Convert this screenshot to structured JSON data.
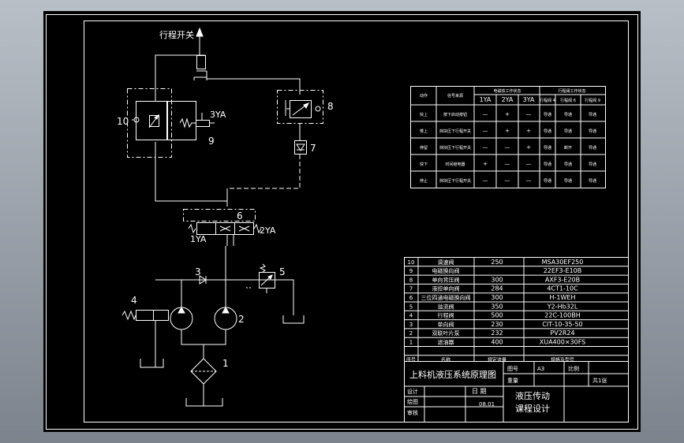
{
  "colors": {
    "frame_bg": "#9aa1ab",
    "sheet": "#000000",
    "line": "#ffffff",
    "grad_top": "#b9bfc7",
    "grad_bottom": "#7d838c"
  },
  "circuit": {
    "limit_switch": "行程开关",
    "labels": {
      "n1": "1",
      "n2": "2",
      "n3": "3",
      "n4": "4",
      "n5": "5",
      "n6": "6",
      "n7": "7",
      "n8": "8",
      "n9": "9",
      "n10": "10",
      "yv1": "1YA",
      "yv2": "2YA",
      "yv3": "3YA"
    }
  },
  "action_table": {
    "header_top": [
      "电磁铁工作状态",
      "行程阀工作状态"
    ],
    "col_action": "动作",
    "col_signal": "信号来源",
    "solenoids": [
      "1YA",
      "2YA",
      "3YA"
    ],
    "valves": [
      "行程阀 4",
      "行程阀 6",
      "行程阀 9"
    ],
    "rows": [
      {
        "action": "快上",
        "signal": "按下启动按钮",
        "s": [
          "—",
          "+",
          "—"
        ],
        "v": [
          "导通",
          "导通",
          "导通"
        ]
      },
      {
        "action": "慢上",
        "signal": "挡块压下行程开关",
        "s": [
          "—",
          "+",
          "+"
        ],
        "v": [
          "导通",
          "导通",
          "导通"
        ]
      },
      {
        "action": "停留",
        "signal": "挡块压下行程开关",
        "s": [
          "—",
          "—",
          "+"
        ],
        "v": [
          "导通",
          "断开",
          "导通"
        ]
      },
      {
        "action": "快下",
        "signal": "时间继电器",
        "s": [
          "+",
          "—",
          "—"
        ],
        "v": [
          "导通",
          "导通",
          "导通"
        ]
      },
      {
        "action": "停止",
        "signal": "挡块压下行程开关",
        "s": [
          "—",
          "—",
          "—"
        ],
        "v": [
          "导通",
          "导通",
          "导通"
        ]
      }
    ]
  },
  "parts_list": {
    "rows": [
      {
        "no": "10",
        "name": "调速阀",
        "spec": "250",
        "model": "MSA30EF250"
      },
      {
        "no": "9",
        "name": "电磁换向阀",
        "spec": "",
        "model": "22EF3-E10B"
      },
      {
        "no": "8",
        "name": "单向背压阀",
        "spec": "300",
        "model": "AXF3-E20B"
      },
      {
        "no": "7",
        "name": "液控单向阀",
        "spec": "284",
        "model": "4CT1-10C"
      },
      {
        "no": "6",
        "name": "三位四通电磁换向阀",
        "spec": "300",
        "model": "H-1WEH"
      },
      {
        "no": "5",
        "name": "溢流阀",
        "spec": "350",
        "model": "Y2-Hb32L"
      },
      {
        "no": "4",
        "name": "行程阀",
        "spec": "500",
        "model": "22C-100BH"
      },
      {
        "no": "3",
        "name": "单向阀",
        "spec": "230",
        "model": "CIT-10-35-50"
      },
      {
        "no": "2",
        "name": "双联叶片泵",
        "spec": "232",
        "model": "PV2R24"
      },
      {
        "no": "1",
        "name": "滤油器",
        "spec": "400",
        "model": "XUA400×30FS"
      }
    ],
    "header": {
      "no": "序号",
      "name": "名称",
      "spec": "规定流量",
      "model": "规格及型号"
    }
  },
  "title_block": {
    "drawing_title": "上料机液压系统原理图",
    "l_drawing_no": "图号",
    "drawing_no": "A3",
    "l_scale": "比例",
    "l_weight": "重量",
    "sheet": "共1张",
    "l_design": "设计",
    "l_check": "绘图",
    "l_review": "审核",
    "l_date": "日  期",
    "date": "08.01",
    "course_line1": "液压传动",
    "course_line2": "课程设计"
  }
}
